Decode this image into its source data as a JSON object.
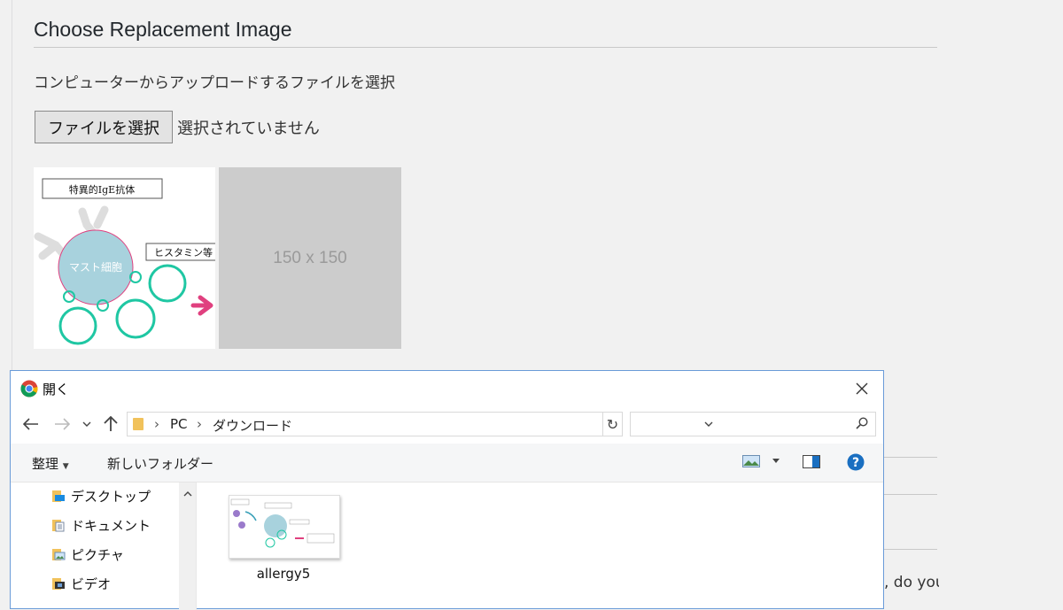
{
  "page": {
    "heading": "Choose Replacement Image",
    "instruction": "コンピューターからアップロードするファイルを選択",
    "file_button_label": "ファイルを選択",
    "file_status": "選択されていません",
    "placeholder_text": "150 x 150",
    "truncated_text": ", do you"
  },
  "thumbnail": {
    "label_top": "特異的IgE抗体",
    "label_right": "ヒスタミン等",
    "cell_label": "マスト細胞"
  },
  "dialog": {
    "title": "開く",
    "breadcrumbs": [
      "PC",
      "ダウンロード"
    ],
    "search_placeholder": "",
    "toolbar": {
      "organize": "整理",
      "new_folder": "新しいフォルダー"
    },
    "sidebar": [
      {
        "label": "デスクトップ",
        "icon": "desktop-folder-icon"
      },
      {
        "label": "ドキュメント",
        "icon": "documents-folder-icon"
      },
      {
        "label": "ピクチャ",
        "icon": "pictures-folder-icon"
      },
      {
        "label": "ビデオ",
        "icon": "videos-folder-icon"
      }
    ],
    "files": [
      {
        "name": "allergy5"
      }
    ]
  },
  "colors": {
    "accent_blue": "#1a6fc1",
    "dialog_border": "#6a9bd8",
    "teal": "#1fc7a3",
    "pink": "#e0407f"
  }
}
